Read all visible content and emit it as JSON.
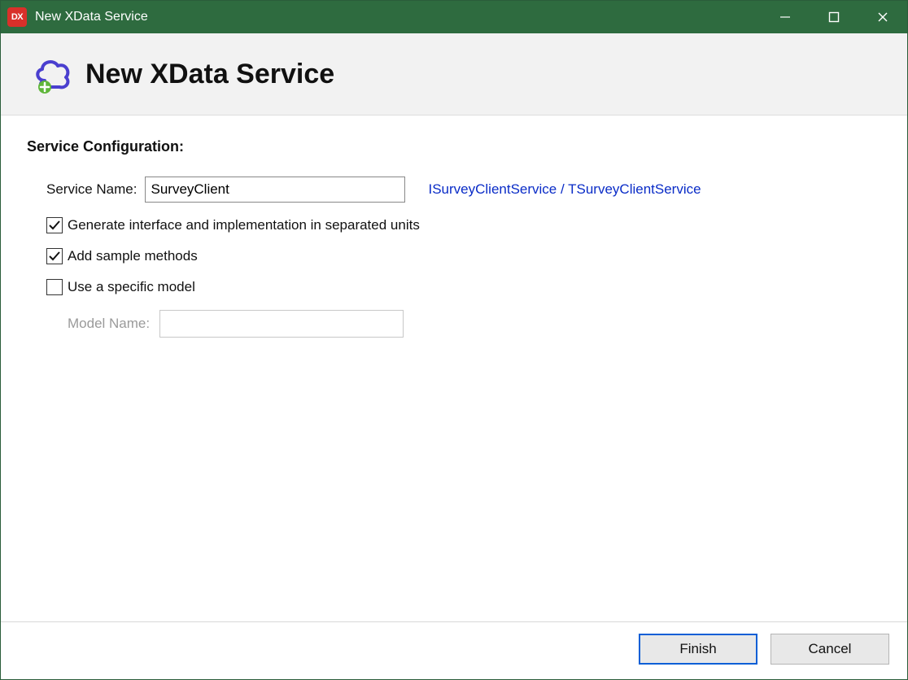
{
  "title_bar": {
    "icon_text": "DX",
    "title": "New XData Service"
  },
  "header": {
    "title": "New XData Service"
  },
  "content": {
    "section_heading": "Service Configuration:",
    "service_name": {
      "label": "Service Name:",
      "value": "SurveyClient",
      "hint": "ISurveyClientService / TSurveyClientService"
    },
    "checkboxes": {
      "separated_units": {
        "label": "Generate interface and implementation in separated units",
        "checked": true
      },
      "sample_methods": {
        "label": "Add sample methods",
        "checked": true
      },
      "specific_model": {
        "label": "Use a specific model",
        "checked": false
      }
    },
    "model_name": {
      "label": "Model Name:",
      "value": ""
    }
  },
  "footer": {
    "finish": "Finish",
    "cancel": "Cancel"
  }
}
